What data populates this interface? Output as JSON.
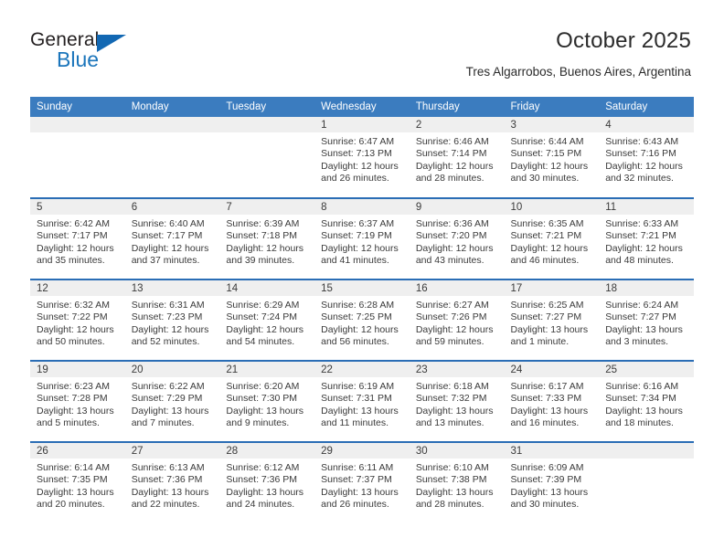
{
  "brand": {
    "name_part1": "General",
    "name_part2": "Blue",
    "triangle_color": "#1268b3",
    "blue_color": "#1b75bb"
  },
  "header": {
    "title": "October 2025",
    "subtitle": "Tres Algarrobos, Buenos Aires, Argentina"
  },
  "theme": {
    "header_bar": "#3b7cbf",
    "row_separator": "#2a6db5",
    "daynum_band": "#efefef",
    "text": "#3a3a3a"
  },
  "calendar": {
    "weekday_headers": [
      "Sunday",
      "Monday",
      "Tuesday",
      "Wednesday",
      "Thursday",
      "Friday",
      "Saturday"
    ],
    "weeks": [
      [
        {
          "day": "",
          "sunrise": "",
          "sunset": "",
          "daylight1": "",
          "daylight2": ""
        },
        {
          "day": "",
          "sunrise": "",
          "sunset": "",
          "daylight1": "",
          "daylight2": ""
        },
        {
          "day": "",
          "sunrise": "",
          "sunset": "",
          "daylight1": "",
          "daylight2": ""
        },
        {
          "day": "1",
          "sunrise": "Sunrise: 6:47 AM",
          "sunset": "Sunset: 7:13 PM",
          "daylight1": "Daylight: 12 hours",
          "daylight2": "and 26 minutes."
        },
        {
          "day": "2",
          "sunrise": "Sunrise: 6:46 AM",
          "sunset": "Sunset: 7:14 PM",
          "daylight1": "Daylight: 12 hours",
          "daylight2": "and 28 minutes."
        },
        {
          "day": "3",
          "sunrise": "Sunrise: 6:44 AM",
          "sunset": "Sunset: 7:15 PM",
          "daylight1": "Daylight: 12 hours",
          "daylight2": "and 30 minutes."
        },
        {
          "day": "4",
          "sunrise": "Sunrise: 6:43 AM",
          "sunset": "Sunset: 7:16 PM",
          "daylight1": "Daylight: 12 hours",
          "daylight2": "and 32 minutes."
        }
      ],
      [
        {
          "day": "5",
          "sunrise": "Sunrise: 6:42 AM",
          "sunset": "Sunset: 7:17 PM",
          "daylight1": "Daylight: 12 hours",
          "daylight2": "and 35 minutes."
        },
        {
          "day": "6",
          "sunrise": "Sunrise: 6:40 AM",
          "sunset": "Sunset: 7:17 PM",
          "daylight1": "Daylight: 12 hours",
          "daylight2": "and 37 minutes."
        },
        {
          "day": "7",
          "sunrise": "Sunrise: 6:39 AM",
          "sunset": "Sunset: 7:18 PM",
          "daylight1": "Daylight: 12 hours",
          "daylight2": "and 39 minutes."
        },
        {
          "day": "8",
          "sunrise": "Sunrise: 6:37 AM",
          "sunset": "Sunset: 7:19 PM",
          "daylight1": "Daylight: 12 hours",
          "daylight2": "and 41 minutes."
        },
        {
          "day": "9",
          "sunrise": "Sunrise: 6:36 AM",
          "sunset": "Sunset: 7:20 PM",
          "daylight1": "Daylight: 12 hours",
          "daylight2": "and 43 minutes."
        },
        {
          "day": "10",
          "sunrise": "Sunrise: 6:35 AM",
          "sunset": "Sunset: 7:21 PM",
          "daylight1": "Daylight: 12 hours",
          "daylight2": "and 46 minutes."
        },
        {
          "day": "11",
          "sunrise": "Sunrise: 6:33 AM",
          "sunset": "Sunset: 7:21 PM",
          "daylight1": "Daylight: 12 hours",
          "daylight2": "and 48 minutes."
        }
      ],
      [
        {
          "day": "12",
          "sunrise": "Sunrise: 6:32 AM",
          "sunset": "Sunset: 7:22 PM",
          "daylight1": "Daylight: 12 hours",
          "daylight2": "and 50 minutes."
        },
        {
          "day": "13",
          "sunrise": "Sunrise: 6:31 AM",
          "sunset": "Sunset: 7:23 PM",
          "daylight1": "Daylight: 12 hours",
          "daylight2": "and 52 minutes."
        },
        {
          "day": "14",
          "sunrise": "Sunrise: 6:29 AM",
          "sunset": "Sunset: 7:24 PM",
          "daylight1": "Daylight: 12 hours",
          "daylight2": "and 54 minutes."
        },
        {
          "day": "15",
          "sunrise": "Sunrise: 6:28 AM",
          "sunset": "Sunset: 7:25 PM",
          "daylight1": "Daylight: 12 hours",
          "daylight2": "and 56 minutes."
        },
        {
          "day": "16",
          "sunrise": "Sunrise: 6:27 AM",
          "sunset": "Sunset: 7:26 PM",
          "daylight1": "Daylight: 12 hours",
          "daylight2": "and 59 minutes."
        },
        {
          "day": "17",
          "sunrise": "Sunrise: 6:25 AM",
          "sunset": "Sunset: 7:27 PM",
          "daylight1": "Daylight: 13 hours",
          "daylight2": "and 1 minute."
        },
        {
          "day": "18",
          "sunrise": "Sunrise: 6:24 AM",
          "sunset": "Sunset: 7:27 PM",
          "daylight1": "Daylight: 13 hours",
          "daylight2": "and 3 minutes."
        }
      ],
      [
        {
          "day": "19",
          "sunrise": "Sunrise: 6:23 AM",
          "sunset": "Sunset: 7:28 PM",
          "daylight1": "Daylight: 13 hours",
          "daylight2": "and 5 minutes."
        },
        {
          "day": "20",
          "sunrise": "Sunrise: 6:22 AM",
          "sunset": "Sunset: 7:29 PM",
          "daylight1": "Daylight: 13 hours",
          "daylight2": "and 7 minutes."
        },
        {
          "day": "21",
          "sunrise": "Sunrise: 6:20 AM",
          "sunset": "Sunset: 7:30 PM",
          "daylight1": "Daylight: 13 hours",
          "daylight2": "and 9 minutes."
        },
        {
          "day": "22",
          "sunrise": "Sunrise: 6:19 AM",
          "sunset": "Sunset: 7:31 PM",
          "daylight1": "Daylight: 13 hours",
          "daylight2": "and 11 minutes."
        },
        {
          "day": "23",
          "sunrise": "Sunrise: 6:18 AM",
          "sunset": "Sunset: 7:32 PM",
          "daylight1": "Daylight: 13 hours",
          "daylight2": "and 13 minutes."
        },
        {
          "day": "24",
          "sunrise": "Sunrise: 6:17 AM",
          "sunset": "Sunset: 7:33 PM",
          "daylight1": "Daylight: 13 hours",
          "daylight2": "and 16 minutes."
        },
        {
          "day": "25",
          "sunrise": "Sunrise: 6:16 AM",
          "sunset": "Sunset: 7:34 PM",
          "daylight1": "Daylight: 13 hours",
          "daylight2": "and 18 minutes."
        }
      ],
      [
        {
          "day": "26",
          "sunrise": "Sunrise: 6:14 AM",
          "sunset": "Sunset: 7:35 PM",
          "daylight1": "Daylight: 13 hours",
          "daylight2": "and 20 minutes."
        },
        {
          "day": "27",
          "sunrise": "Sunrise: 6:13 AM",
          "sunset": "Sunset: 7:36 PM",
          "daylight1": "Daylight: 13 hours",
          "daylight2": "and 22 minutes."
        },
        {
          "day": "28",
          "sunrise": "Sunrise: 6:12 AM",
          "sunset": "Sunset: 7:36 PM",
          "daylight1": "Daylight: 13 hours",
          "daylight2": "and 24 minutes."
        },
        {
          "day": "29",
          "sunrise": "Sunrise: 6:11 AM",
          "sunset": "Sunset: 7:37 PM",
          "daylight1": "Daylight: 13 hours",
          "daylight2": "and 26 minutes."
        },
        {
          "day": "30",
          "sunrise": "Sunrise: 6:10 AM",
          "sunset": "Sunset: 7:38 PM",
          "daylight1": "Daylight: 13 hours",
          "daylight2": "and 28 minutes."
        },
        {
          "day": "31",
          "sunrise": "Sunrise: 6:09 AM",
          "sunset": "Sunset: 7:39 PM",
          "daylight1": "Daylight: 13 hours",
          "daylight2": "and 30 minutes."
        },
        {
          "day": "",
          "sunrise": "",
          "sunset": "",
          "daylight1": "",
          "daylight2": ""
        }
      ]
    ]
  }
}
